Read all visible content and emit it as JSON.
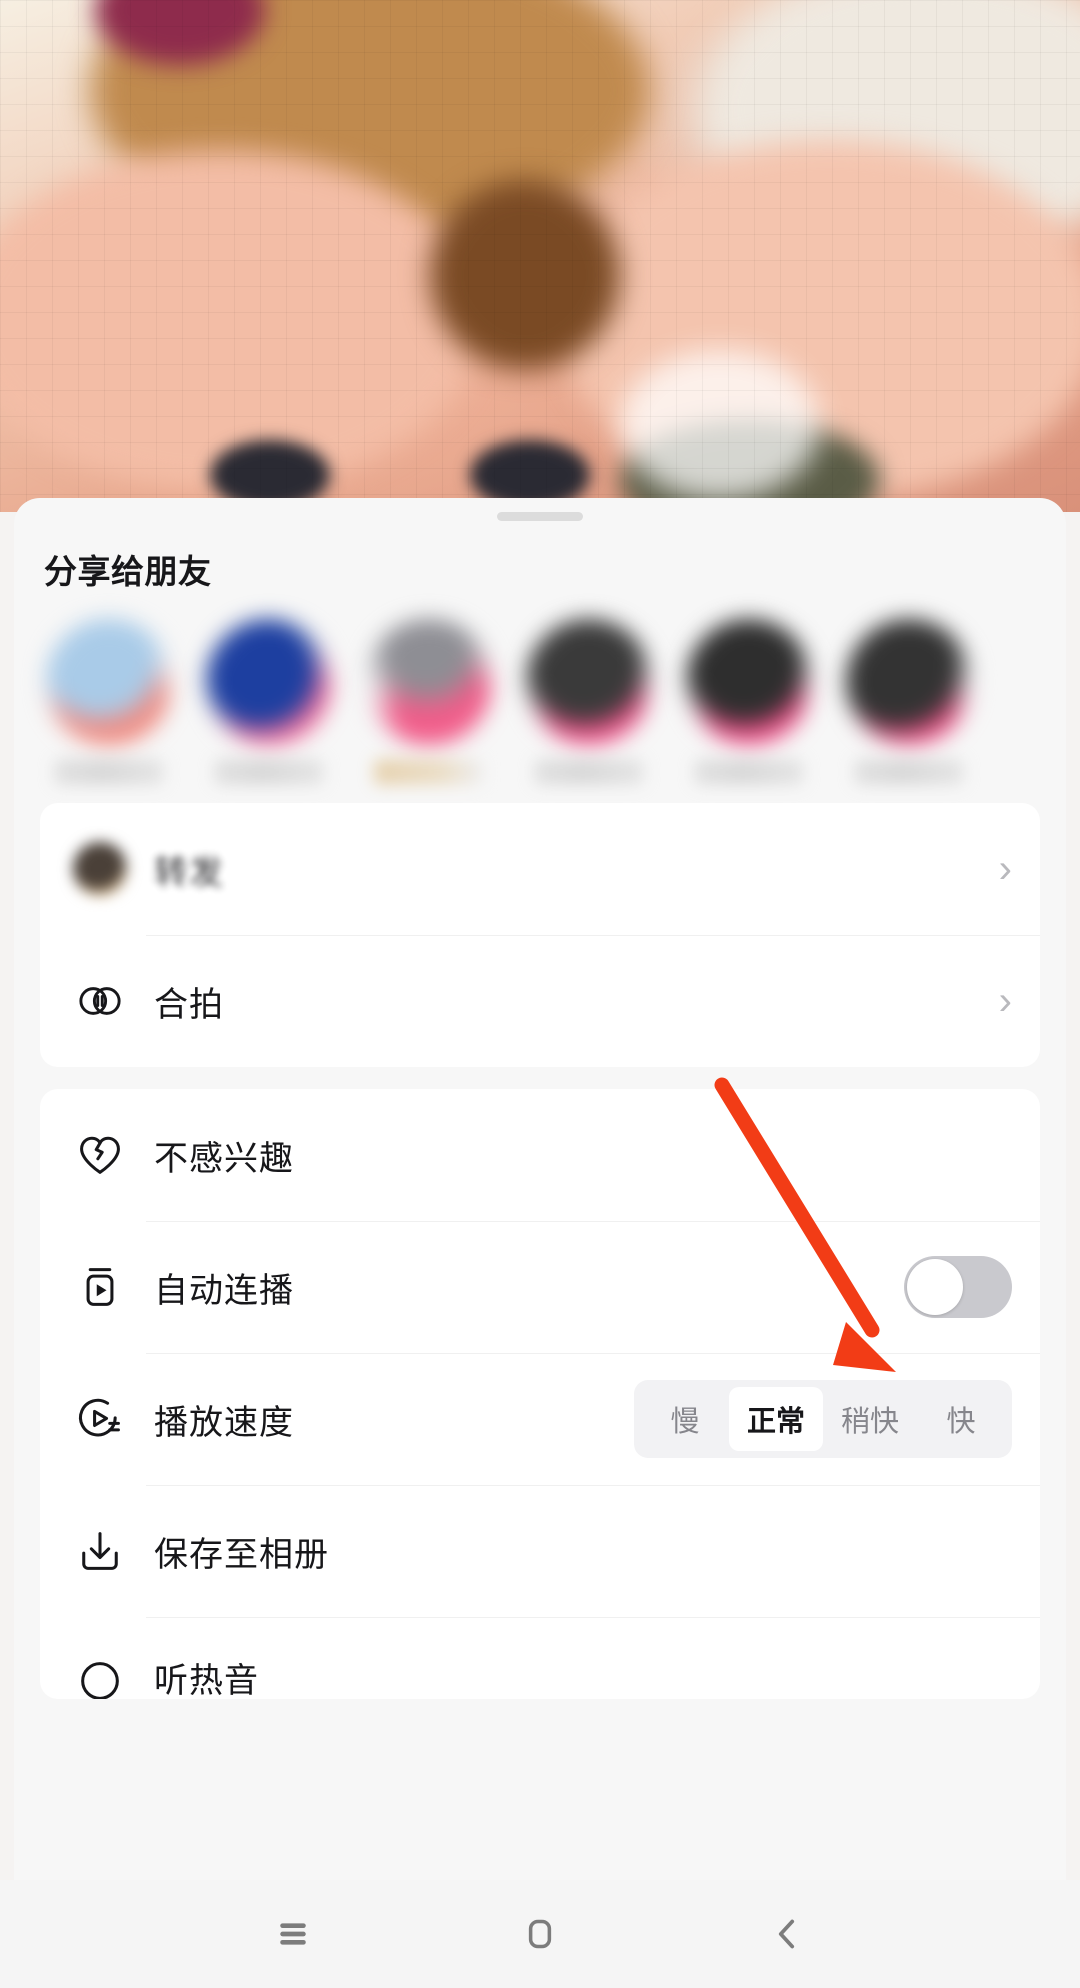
{
  "sheet": {
    "title": "分享给朋友",
    "drag_handle": "drag-handle"
  },
  "share_targets": [
    {
      "name": "",
      "avatar_colors": [
        "#a9cbe8",
        "#f08a80",
        "#f3b9ae"
      ]
    },
    {
      "name": "",
      "avatar_colors": [
        "#1d3fa0",
        "#f06b9a",
        "#d7d7dd"
      ]
    },
    {
      "name": "",
      "avatar_colors": [
        "#e6e6ea",
        "#f15d8a",
        "#d9a85c"
      ]
    },
    {
      "name": "",
      "avatar_colors": [
        "#3a3a3a",
        "#f0548a",
        "#c9c9cf"
      ]
    },
    {
      "name": "",
      "avatar_colors": [
        "#2e2e2e",
        "#ef5088",
        "#cfcfd5"
      ]
    },
    {
      "name": "",
      "avatar_colors": [
        "#333333",
        "#ee5186",
        "#cccccc"
      ]
    }
  ],
  "card_one": {
    "rows": [
      {
        "icon": "avatar-repost-icon",
        "label": "转发",
        "accessory": "chevron",
        "blurred": true
      },
      {
        "icon": "duet-icon",
        "label": "合拍",
        "accessory": "chevron",
        "blurred": false
      }
    ]
  },
  "card_two": {
    "rows": [
      {
        "icon": "broken-heart-icon",
        "label": "不感兴趣",
        "accessory": "none"
      },
      {
        "icon": "autoplay-icon",
        "label": "自动连播",
        "accessory": "toggle",
        "toggle_state": "off"
      },
      {
        "icon": "playback-speed-icon",
        "label": "播放速度",
        "accessory": "segmented"
      },
      {
        "icon": "download-icon",
        "label": "保存至相册",
        "accessory": "none"
      },
      {
        "icon": "listen-icon",
        "label": "听热音",
        "accessory": "none"
      }
    ]
  },
  "playback_speed": {
    "options": [
      "慢",
      "正常",
      "稍快",
      "快"
    ],
    "selected": "正常"
  },
  "annotation": {
    "arrow_color": "#f23c16",
    "points_to": "自动连播 toggle"
  },
  "nav_bar": {
    "buttons": [
      {
        "name": "recents-button",
        "icon": "menu-icon"
      },
      {
        "name": "home-button",
        "icon": "home-square-icon"
      },
      {
        "name": "back-button",
        "icon": "chevron-left-icon"
      }
    ]
  },
  "colors": {
    "accent": "#fe2c55",
    "arrow": "#f23c16",
    "sheet_bg": "#f7f7f7",
    "card_bg": "#ffffff",
    "toggle_off": "#c9c9ce",
    "text_primary": "#17171a",
    "text_muted": "#86868c",
    "nav_bar_bg": "#f5f5f5"
  }
}
